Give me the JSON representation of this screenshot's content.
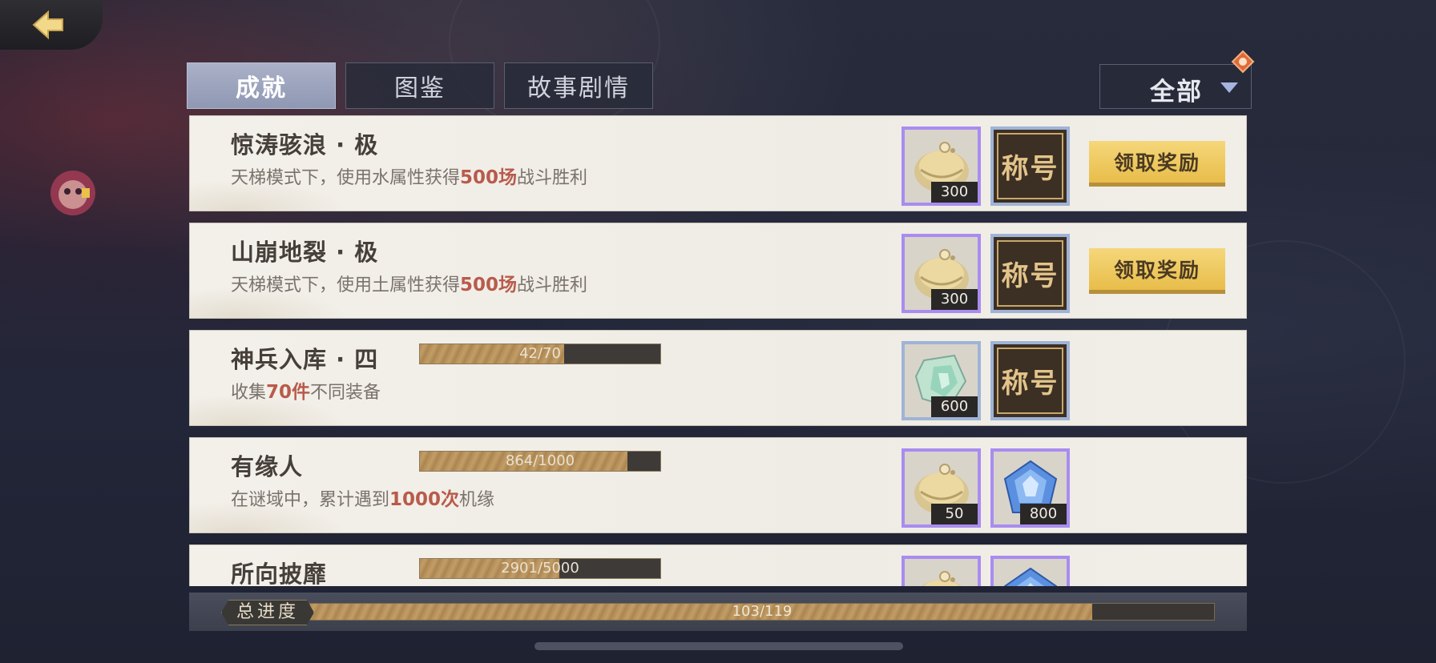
{
  "tabs": [
    {
      "label": "成就",
      "active": true
    },
    {
      "label": "图鉴",
      "active": false
    },
    {
      "label": "故事剧情",
      "active": false
    }
  ],
  "filter": {
    "label": "全部"
  },
  "achievements": [
    {
      "title": "惊涛骇浪 · 极",
      "desc_pre": "天梯模式下，使用水属性获得",
      "desc_hl": "500场",
      "desc_post": "战斗胜利",
      "progress": null,
      "rewards": [
        {
          "type": "gold-ingot-icon",
          "count": "300",
          "frame": "purple"
        },
        {
          "type": "title",
          "label": "称号"
        }
      ],
      "claim_label": "领取奖励"
    },
    {
      "title": "山崩地裂 · 极",
      "desc_pre": "天梯模式下，使用土属性获得",
      "desc_hl": "500场",
      "desc_post": "战斗胜利",
      "progress": null,
      "rewards": [
        {
          "type": "gold-ingot-icon",
          "count": "300",
          "frame": "purple"
        },
        {
          "type": "title",
          "label": "称号"
        }
      ],
      "claim_label": "领取奖励"
    },
    {
      "title": "神兵入库 · 四",
      "desc_pre": "收集",
      "desc_hl": "70件",
      "desc_post": "不同装备",
      "progress": {
        "text": "42/70",
        "value": 42,
        "max": 70
      },
      "rewards": [
        {
          "type": "jade-crystal-icon",
          "count": "600",
          "frame": "blue"
        },
        {
          "type": "title",
          "label": "称号"
        }
      ],
      "claim_label": null
    },
    {
      "title": "有缘人",
      "desc_pre": "在谜域中，累计遇到",
      "desc_hl": "1000次",
      "desc_post": "机缘",
      "progress": {
        "text": "864/1000",
        "value": 864,
        "max": 1000
      },
      "rewards": [
        {
          "type": "gold-ingot-icon",
          "count": "50",
          "frame": "purple"
        },
        {
          "type": "blue-gem-icon",
          "count": "800",
          "frame": "purple"
        }
      ],
      "claim_label": null
    },
    {
      "title": "所向披靡",
      "desc_pre": "",
      "desc_hl": "",
      "desc_post": "",
      "progress": {
        "text": "2901/5000",
        "value": 2901,
        "max": 5000
      },
      "rewards": [
        {
          "type": "gold-ingot-icon",
          "count": "",
          "frame": "purple"
        },
        {
          "type": "blue-gem-icon",
          "count": "",
          "frame": "purple"
        }
      ],
      "claim_label": null
    }
  ],
  "total": {
    "label": "总进度",
    "text": "103/119",
    "value": 103,
    "max": 119
  },
  "colors": {
    "highlight": "#b85b4b",
    "claim_button": "#f0cc62",
    "purple_frame": "#a98cf0",
    "blue_frame": "#9fb3d6",
    "progress_fill": "#b99459"
  }
}
